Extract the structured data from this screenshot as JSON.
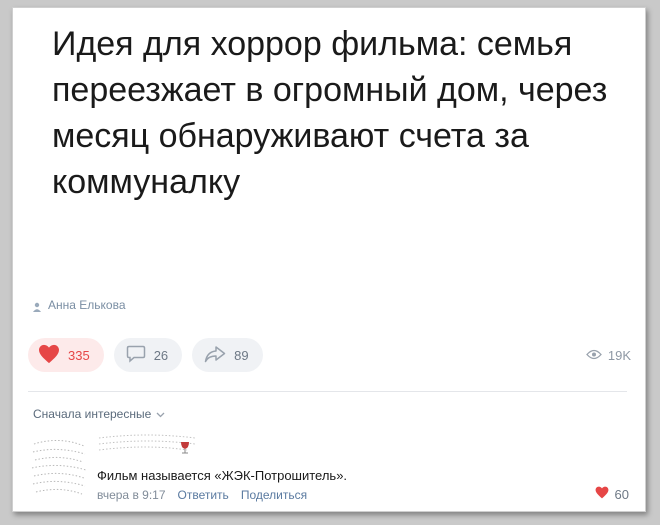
{
  "post": {
    "text": "Идея для хоррор фильма: семья переезжает в огромный дом, через месяц обнаруживают счета за коммуналку",
    "author": "Анна Елькова"
  },
  "actions": {
    "likes": "335",
    "comments": "26",
    "shares": "89",
    "views": "19K"
  },
  "comments_section": {
    "sort_label": "Сначала интересные",
    "comment": {
      "text": "Фильм называется «ЖЭК-Потрошитель».",
      "time": "вчера в 9:17",
      "reply_label": "Ответить",
      "share_label": "Поделиться",
      "likes": "60"
    }
  },
  "colors": {
    "like_red": "#e64646",
    "muted_text": "#818c99",
    "link_blue": "#5a7aa0"
  }
}
